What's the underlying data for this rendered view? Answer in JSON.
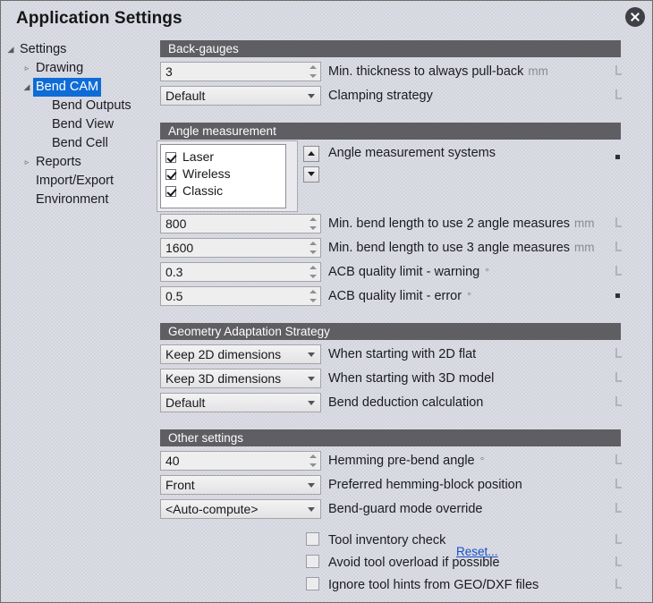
{
  "window": {
    "title": "Application Settings",
    "close_icon": "close-icon"
  },
  "sidebar": {
    "items": [
      {
        "label": "Settings",
        "depth": 0,
        "twisty": "expanded",
        "selected": false
      },
      {
        "label": "Drawing",
        "depth": 1,
        "twisty": "collapsed",
        "selected": false
      },
      {
        "label": "Bend CAM",
        "depth": 1,
        "twisty": "expanded",
        "selected": true
      },
      {
        "label": "Bend Outputs",
        "depth": 2,
        "twisty": "none",
        "selected": false
      },
      {
        "label": "Bend View",
        "depth": 2,
        "twisty": "none",
        "selected": false
      },
      {
        "label": "Bend Cell",
        "depth": 2,
        "twisty": "none",
        "selected": false
      },
      {
        "label": "Reports",
        "depth": 1,
        "twisty": "collapsed",
        "selected": false
      },
      {
        "label": "Import/Export",
        "depth": 1,
        "twisty": "none",
        "selected": false
      },
      {
        "label": "Environment",
        "depth": 1,
        "twisty": "none",
        "selected": false
      }
    ]
  },
  "groups": {
    "back_gauges": {
      "header": "Back-gauges",
      "rows": [
        {
          "value": "3",
          "label": "Min. thickness to always pull-back",
          "unit": "mm",
          "marker": "l"
        },
        {
          "value": "Default",
          "label": "Clamping strategy",
          "unit": "",
          "marker": "l"
        }
      ]
    },
    "angle_measurement": {
      "header": "Angle measurement",
      "list_label": "Angle measurement systems",
      "list_marker": "dot",
      "list_items": [
        {
          "label": "Laser",
          "checked": true
        },
        {
          "label": "Wireless",
          "checked": true
        },
        {
          "label": "Classic",
          "checked": true
        }
      ],
      "scroll_up_icon": "triangle-up-icon",
      "scroll_down_icon": "triangle-down-icon",
      "rows": [
        {
          "value": "800",
          "label": "Min. bend length to use 2 angle measures",
          "unit": "mm",
          "marker": "l"
        },
        {
          "value": "1600",
          "label": "Min. bend length to use 3 angle measures",
          "unit": "mm",
          "marker": "l"
        },
        {
          "value": "0.3",
          "label": "ACB quality limit - warning",
          "unit": "°",
          "marker": "l"
        },
        {
          "value": "0.5",
          "label": "ACB quality limit - error",
          "unit": "°",
          "marker": "dot"
        }
      ]
    },
    "geometry_adaptation": {
      "header": "Geometry Adaptation Strategy",
      "rows": [
        {
          "value": "Keep 2D dimensions",
          "label": "When starting with 2D flat",
          "unit": "",
          "marker": "l"
        },
        {
          "value": "Keep 3D dimensions",
          "label": "When starting with 3D model",
          "unit": "",
          "marker": "l"
        },
        {
          "value": "Default",
          "label": "Bend deduction calculation",
          "unit": "",
          "marker": "l"
        }
      ]
    },
    "other_settings": {
      "header": "Other settings",
      "rows": [
        {
          "value": "40",
          "label": "Hemming pre-bend angle",
          "unit": "°",
          "marker": "l"
        },
        {
          "value": "Front",
          "label": "Preferred hemming-block position",
          "unit": "",
          "marker": "l"
        },
        {
          "value": "<Auto-compute>",
          "label": "Bend-guard mode override",
          "unit": "",
          "marker": "l"
        }
      ],
      "checkboxes": [
        {
          "label": "Tool inventory check",
          "checked": false,
          "marker": "l"
        },
        {
          "label": "Avoid tool overload if possible",
          "checked": false,
          "marker": "l"
        },
        {
          "label": "Ignore tool hints from GEO/DXF files",
          "checked": false,
          "marker": "l"
        }
      ]
    }
  },
  "footer": {
    "reset_label": "Reset..."
  },
  "colors": {
    "accent": "#0f6cd6",
    "group_header_bg": "#5e5e63",
    "link": "#1452c8",
    "background": "#dcdde4"
  }
}
